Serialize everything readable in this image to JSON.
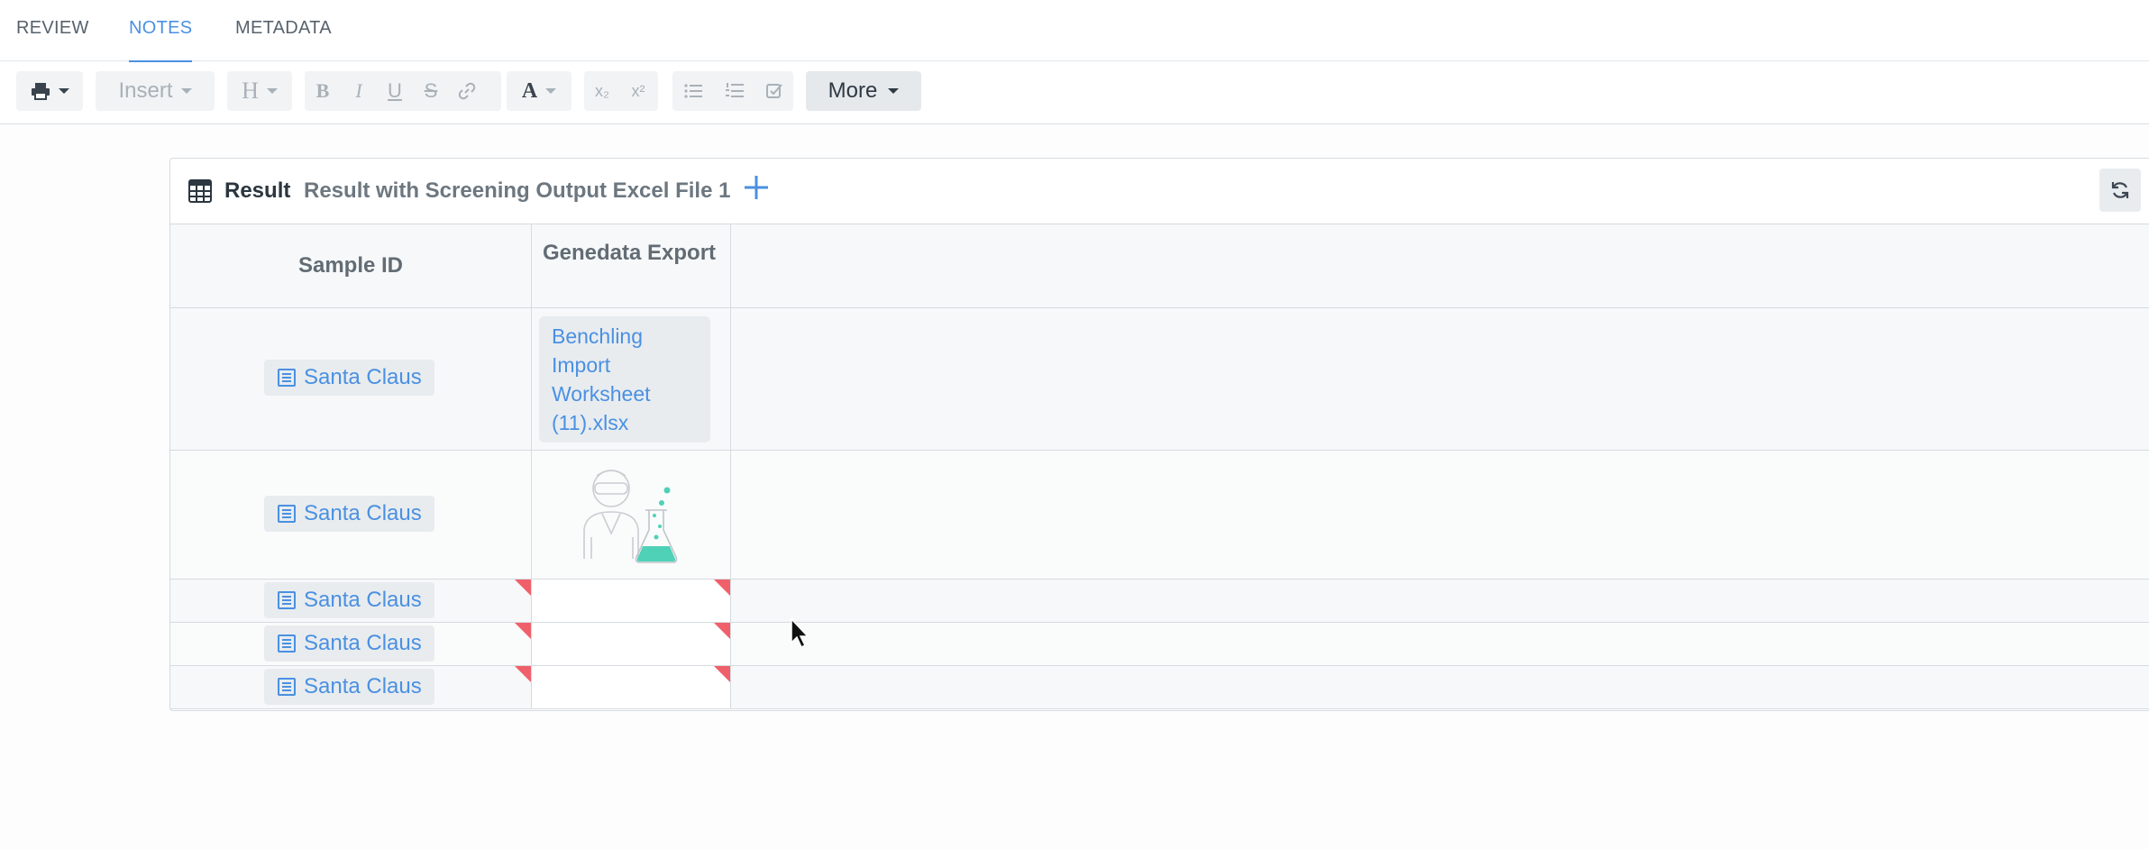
{
  "tabs": [
    {
      "label": "REVIEW",
      "active": false
    },
    {
      "label": "NOTES",
      "active": true
    },
    {
      "label": "METADATA",
      "active": false
    }
  ],
  "toolbar": {
    "insert_label": "Insert",
    "heading_label": "H",
    "bold_label": "B",
    "italic_label": "I",
    "underline_label": "U",
    "strike_label": "S",
    "font_color_label": "A",
    "subscript_label": "x₂",
    "superscript_label": "x²",
    "more_label": "More"
  },
  "result": {
    "label": "Result",
    "name": "Result with Screening Output Excel File 1",
    "columns": [
      "Sample ID",
      "Genedata Export"
    ],
    "rows": [
      {
        "sample": "Santa Claus",
        "export": "Benchling Import Worksheet (11).xlsx",
        "export_type": "file",
        "flagged": false
      },
      {
        "sample": "Santa Claus",
        "export": "",
        "export_type": "empty-illustration",
        "flagged": false
      },
      {
        "sample": "Santa Claus",
        "export": "",
        "export_type": "blank",
        "flagged": true
      },
      {
        "sample": "Santa Claus",
        "export": "",
        "export_type": "blank",
        "flagged": true
      },
      {
        "sample": "Santa Claus",
        "export": "",
        "export_type": "blank",
        "flagged": true
      }
    ]
  },
  "colors": {
    "accent": "#4a90e2",
    "flag": "#f0606b",
    "illustration_flask": "#4fd1b8"
  }
}
